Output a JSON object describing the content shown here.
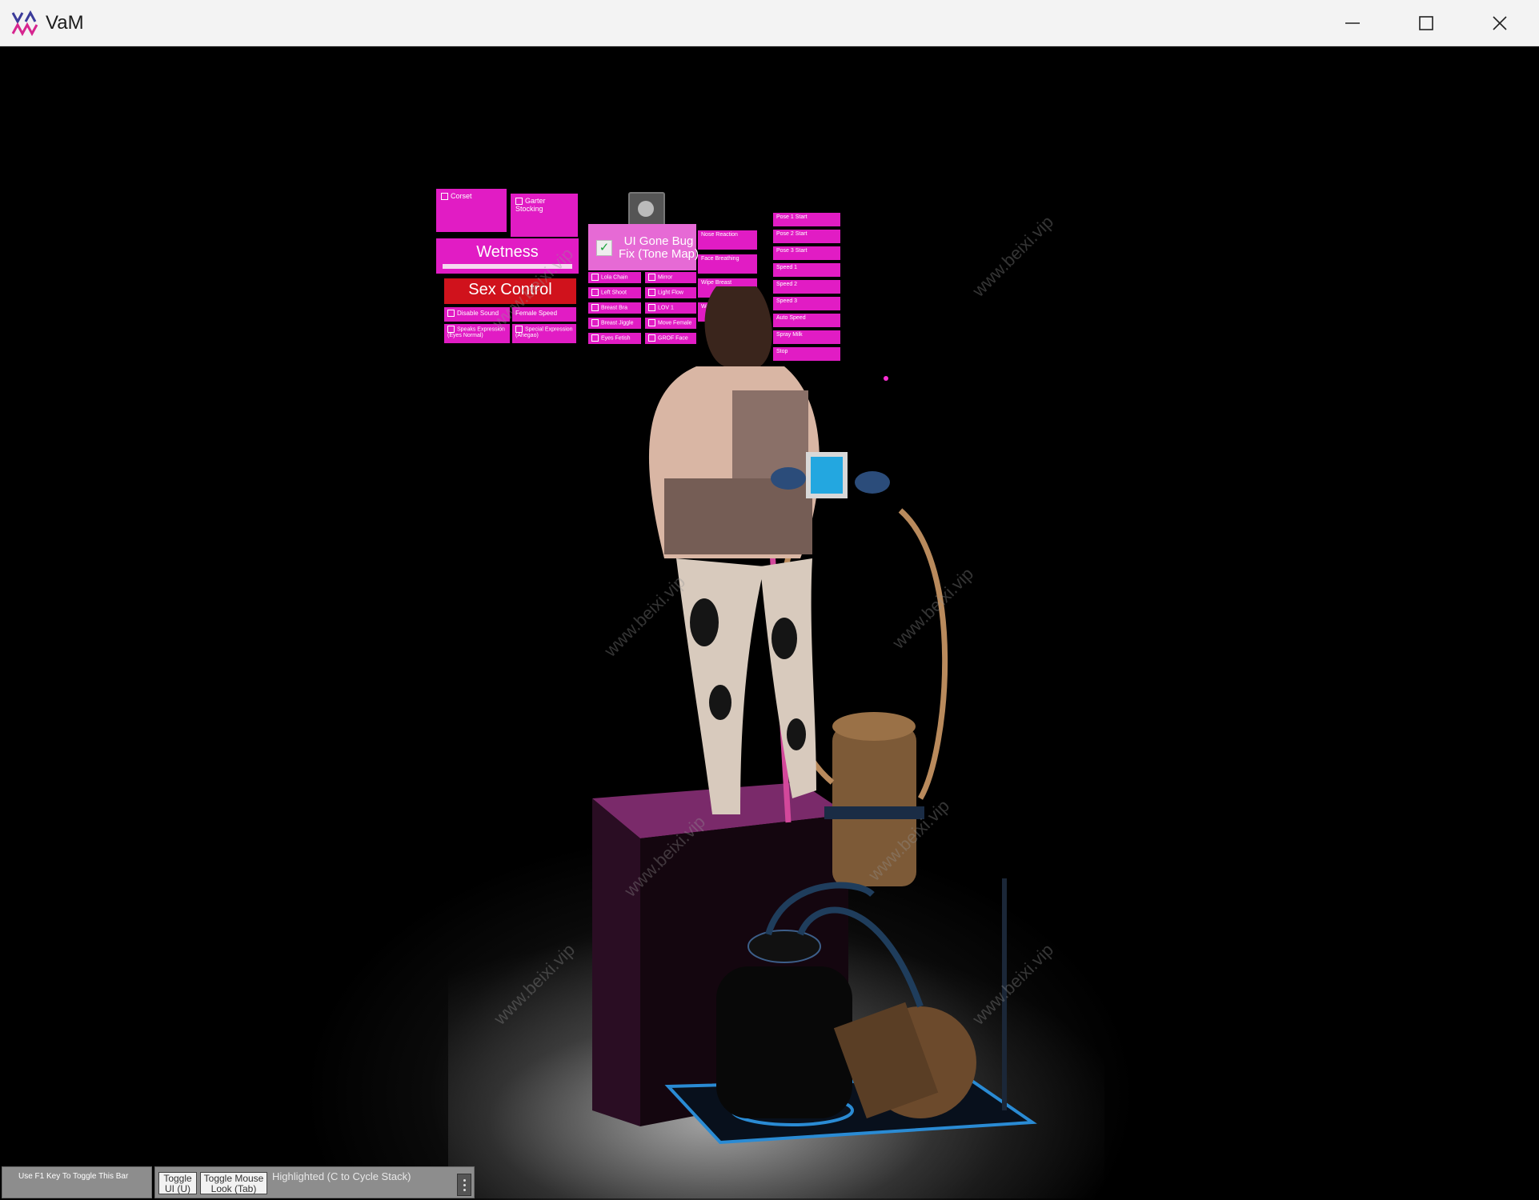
{
  "window": {
    "title": "VaM",
    "minimize_icon": "minimize-icon",
    "maximize_icon": "maximize-icon",
    "close_icon": "close-icon"
  },
  "panels": {
    "corset_label": "Corset",
    "garter_label": "Garter Stocking",
    "wetness_label": "Wetness",
    "sex_control_label": "Sex Control",
    "disable_sound_label": "Disable Sound",
    "female_speed_label": "Female Speed",
    "speaks_expression_label": "Speaks Expression (Eyes Normal)",
    "special_expression_label": "Special Expression (Ahegao)",
    "tone_map_label": "UI Gone Bug Fix (Tone Map)",
    "left_list": [
      "Lola Chain",
      "Left Shoot",
      "Breast Bra",
      "Breast Jiggle",
      "Eyes Fetish"
    ],
    "mid_list": [
      "Mirror",
      "Light Flow",
      "LOV 1",
      "Move Female",
      "GROF Face"
    ],
    "right_col": [
      "Nose Reaction",
      "Face Breathing",
      "Wipe Breast",
      "Wear"
    ],
    "far_right": [
      "Pose 1 Start",
      "Pose 2 Start",
      "Pose 3 Start",
      "Speed 1",
      "Speed 2",
      "Speed 3",
      "Auto Speed",
      "Spray Milk",
      "Stop"
    ]
  },
  "watermark": "www.beixi.vip",
  "toolbar": {
    "hint": "Use F1 Key To Toggle This Bar",
    "toggle_ui_line1": "Toggle",
    "toggle_ui_line2": "UI (U)",
    "toggle_mouse_line1": "Toggle Mouse",
    "toggle_mouse_line2": "Look (Tab)",
    "highlighted": "Highlighted (C to Cycle Stack)"
  },
  "colors": {
    "panel_pink": "#e11cc4",
    "panel_red": "#d0121c",
    "titlebar_bg": "#f3f3f3",
    "toolbar_bg": "#8d8d8d"
  }
}
